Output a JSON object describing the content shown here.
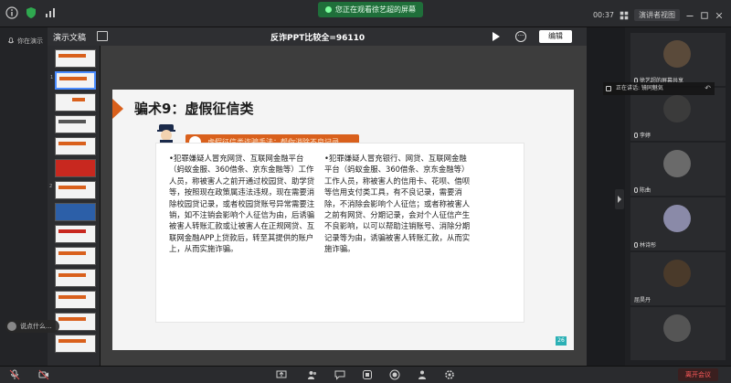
{
  "topbar": {
    "share_banner": "您正在观看徐艺超的屏幕",
    "time": "00:37",
    "view_button": "演讲者视图"
  },
  "left": {
    "user_label": "你在演示"
  },
  "presentation": {
    "panel_label": "演示文稿",
    "title": "反诈PPT比较全=96110",
    "edit_button": "编辑"
  },
  "slide": {
    "title": "骗术9：虚假征信类",
    "banner_text": "虚假征信类诈骗手法：帮你消除不良记录",
    "col1": "•犯罪嫌疑人冒充网贷、互联网金融平台（蚂蚁金服、360借条、京东金融等）工作人员，称被害人之前开通过校园贷、助学贷等，按照现在政策属违法违规，现在需要消除校园贷记录，或者校园贷账号异常需要注销，如不注销会影响个人征信为由，后诱骗被害人转账汇款或让被害人在正规网贷、互联网金融APP上贷款后，转至其提供的账户上，从而实施诈骗。",
    "col2": "•犯罪嫌疑人冒充银行、网贷、互联网金融平台（蚂蚁金服、360借条、京东金融等）工作人员，称被害人的信用卡、花呗、借呗等信用支付类工具，有不良记录，需要消除，不消除会影响个人征信；或者称被害人之前有网贷、分期记录，会对个人征信产生不良影响，以可以帮助注销账号、消除分期记录等为由，诱骗被害人转账汇款，从而实施诈骗。",
    "page_number": "26"
  },
  "speaking": {
    "text": "正在讲话: 镜同魅気"
  },
  "participants": [
    {
      "name": "徐艺超的屏幕共享",
      "color": "#5a4a3a"
    },
    {
      "name": "李婷",
      "color": "#3b3b3b"
    },
    {
      "name": "陈曲",
      "color": "#6a6a6a"
    },
    {
      "name": "林诗彤",
      "color": "#8a8aa8"
    },
    {
      "name": "屈昊丹",
      "color": "#4a3a2a"
    },
    {
      "name": "",
      "color": "#555555"
    }
  ],
  "chat": {
    "hint": "说点什么..."
  },
  "toolbar": {
    "leave_button": "离开会议"
  },
  "thumbnails": [
    "",
    "1",
    "",
    "",
    "",
    "",
    "2",
    "",
    "",
    "",
    "",
    "",
    "",
    ""
  ]
}
